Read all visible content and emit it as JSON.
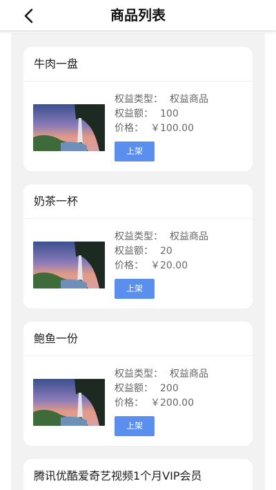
{
  "header": {
    "title": "商品列表",
    "back_icon": "chevron-left-icon"
  },
  "labels": {
    "type": "权益类型：",
    "amount": "权益额：",
    "price": "价格："
  },
  "products": [
    {
      "name": "牛肉一盘",
      "type": "权益商品",
      "amount": "100",
      "price": "￥100.00",
      "button": "上架"
    },
    {
      "name": "奶茶一杯",
      "type": "权益商品",
      "amount": "20",
      "price": "￥20.00",
      "button": "上架"
    },
    {
      "name": "鲍鱼一份",
      "type": "权益商品",
      "amount": "200",
      "price": "￥200.00",
      "button": "上架"
    },
    {
      "name": "腾讯优酷爱奇艺视频1个月VIP会员"
    }
  ],
  "colors": {
    "accent": "#5a8fee",
    "background": "#f2f2f2"
  }
}
